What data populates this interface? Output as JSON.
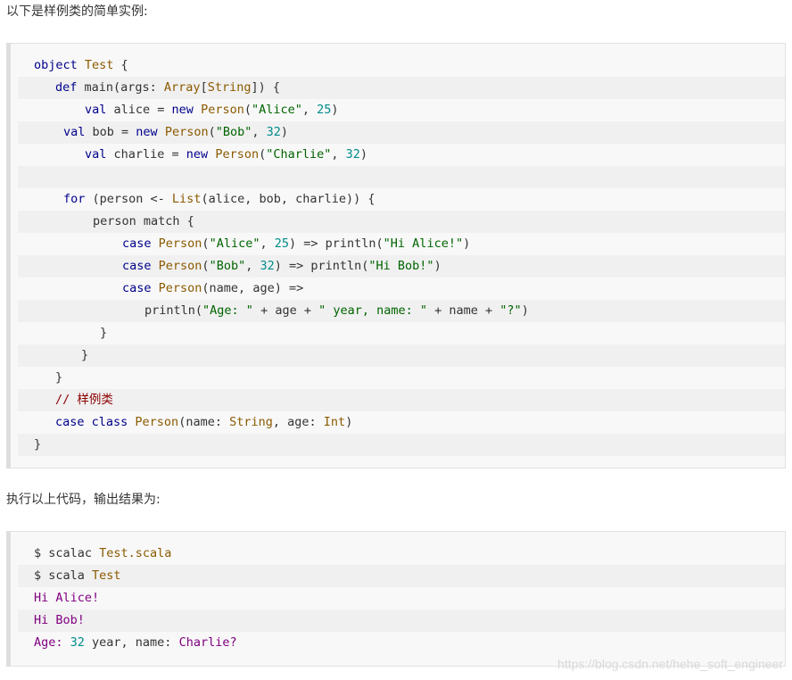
{
  "intro_text": "以下是样例类的简单实例:",
  "output_intro_text": "执行以上代码，输出结果为:",
  "watermark": "https://blog.csdn.net/hehe_soft_engineer",
  "source_code": {
    "lines": [
      [
        {
          "t": "object ",
          "c": "kw"
        },
        {
          "t": "Test",
          "c": "ty"
        },
        {
          "t": " {",
          "c": "plain"
        }
      ],
      [
        {
          "t": "def ",
          "c": "kw"
        },
        {
          "t": "main(args: ",
          "c": "plain"
        },
        {
          "t": "Array",
          "c": "ty"
        },
        {
          "t": "[",
          "c": "plain"
        },
        {
          "t": "String",
          "c": "ty"
        },
        {
          "t": "]) {",
          "c": "plain"
        }
      ],
      [
        {
          "t": "val ",
          "c": "kw"
        },
        {
          "t": "alice = ",
          "c": "plain"
        },
        {
          "t": "new ",
          "c": "kw"
        },
        {
          "t": "Person",
          "c": "ty"
        },
        {
          "t": "(",
          "c": "plain"
        },
        {
          "t": "\"Alice\"",
          "c": "str"
        },
        {
          "t": ", ",
          "c": "plain"
        },
        {
          "t": "25",
          "c": "num"
        },
        {
          "t": ")",
          "c": "plain"
        }
      ],
      [
        {
          "t": "val ",
          "c": "kw"
        },
        {
          "t": "bob = ",
          "c": "plain"
        },
        {
          "t": "new ",
          "c": "kw"
        },
        {
          "t": "Person",
          "c": "ty"
        },
        {
          "t": "(",
          "c": "plain"
        },
        {
          "t": "\"Bob\"",
          "c": "str"
        },
        {
          "t": ", ",
          "c": "plain"
        },
        {
          "t": "32",
          "c": "num"
        },
        {
          "t": ")",
          "c": "plain"
        }
      ],
      [
        {
          "t": "val ",
          "c": "kw"
        },
        {
          "t": "charlie = ",
          "c": "plain"
        },
        {
          "t": "new ",
          "c": "kw"
        },
        {
          "t": "Person",
          "c": "ty"
        },
        {
          "t": "(",
          "c": "plain"
        },
        {
          "t": "\"Charlie\"",
          "c": "str"
        },
        {
          "t": ", ",
          "c": "plain"
        },
        {
          "t": "32",
          "c": "num"
        },
        {
          "t": ")",
          "c": "plain"
        }
      ],
      [],
      [
        {
          "t": "for ",
          "c": "kw"
        },
        {
          "t": "(person <- ",
          "c": "plain"
        },
        {
          "t": "List",
          "c": "ty"
        },
        {
          "t": "(alice, bob, charlie)) {",
          "c": "plain"
        }
      ],
      [
        {
          "t": "person match {",
          "c": "plain"
        }
      ],
      [
        {
          "t": "case ",
          "c": "kw"
        },
        {
          "t": "Person",
          "c": "ty"
        },
        {
          "t": "(",
          "c": "plain"
        },
        {
          "t": "\"Alice\"",
          "c": "str"
        },
        {
          "t": ", ",
          "c": "plain"
        },
        {
          "t": "25",
          "c": "num"
        },
        {
          "t": ") => println(",
          "c": "plain"
        },
        {
          "t": "\"Hi Alice!\"",
          "c": "str"
        },
        {
          "t": ")",
          "c": "plain"
        }
      ],
      [
        {
          "t": "case ",
          "c": "kw"
        },
        {
          "t": "Person",
          "c": "ty"
        },
        {
          "t": "(",
          "c": "plain"
        },
        {
          "t": "\"Bob\"",
          "c": "str"
        },
        {
          "t": ", ",
          "c": "plain"
        },
        {
          "t": "32",
          "c": "num"
        },
        {
          "t": ") => println(",
          "c": "plain"
        },
        {
          "t": "\"Hi Bob!\"",
          "c": "str"
        },
        {
          "t": ")",
          "c": "plain"
        }
      ],
      [
        {
          "t": "case ",
          "c": "kw"
        },
        {
          "t": "Person",
          "c": "ty"
        },
        {
          "t": "(name, age) =>",
          "c": "plain"
        }
      ],
      [
        {
          "t": "println(",
          "c": "plain"
        },
        {
          "t": "\"Age: \"",
          "c": "str"
        },
        {
          "t": " + age + ",
          "c": "plain"
        },
        {
          "t": "\" year, name: \"",
          "c": "str"
        },
        {
          "t": " + name + ",
          "c": "plain"
        },
        {
          "t": "\"?\"",
          "c": "str"
        },
        {
          "t": ")",
          "c": "plain"
        }
      ],
      [
        {
          "t": "}",
          "c": "plain"
        }
      ],
      [
        {
          "t": "}",
          "c": "plain"
        }
      ],
      [
        {
          "t": "}",
          "c": "plain"
        }
      ],
      [
        {
          "t": "// 样例类",
          "c": "cmt"
        }
      ],
      [
        {
          "t": "case ",
          "c": "kw"
        },
        {
          "t": "class ",
          "c": "kw"
        },
        {
          "t": "Person",
          "c": "ty"
        },
        {
          "t": "(name: ",
          "c": "plain"
        },
        {
          "t": "String",
          "c": "ty"
        },
        {
          "t": ", age: ",
          "c": "plain"
        },
        {
          "t": "Int",
          "c": "ty"
        },
        {
          "t": ")",
          "c": "plain"
        }
      ],
      [
        {
          "t": "}",
          "c": "plain"
        }
      ]
    ]
  },
  "output_code": {
    "lines": [
      [
        {
          "t": "$ scalac ",
          "c": "plain"
        },
        {
          "t": "Test.scala",
          "c": "ty"
        }
      ],
      [
        {
          "t": "$ scala ",
          "c": "plain"
        },
        {
          "t": "Test",
          "c": "ty"
        }
      ],
      [
        {
          "t": "Hi Alice!",
          "c": "purple"
        }
      ],
      [
        {
          "t": "Hi Bob!",
          "c": "purple"
        }
      ],
      [
        {
          "t": "Age: ",
          "c": "purple"
        },
        {
          "t": "32",
          "c": "num"
        },
        {
          "t": " year, name: ",
          "c": "plain"
        },
        {
          "t": "Charlie?",
          "c": "purple"
        }
      ]
    ]
  }
}
